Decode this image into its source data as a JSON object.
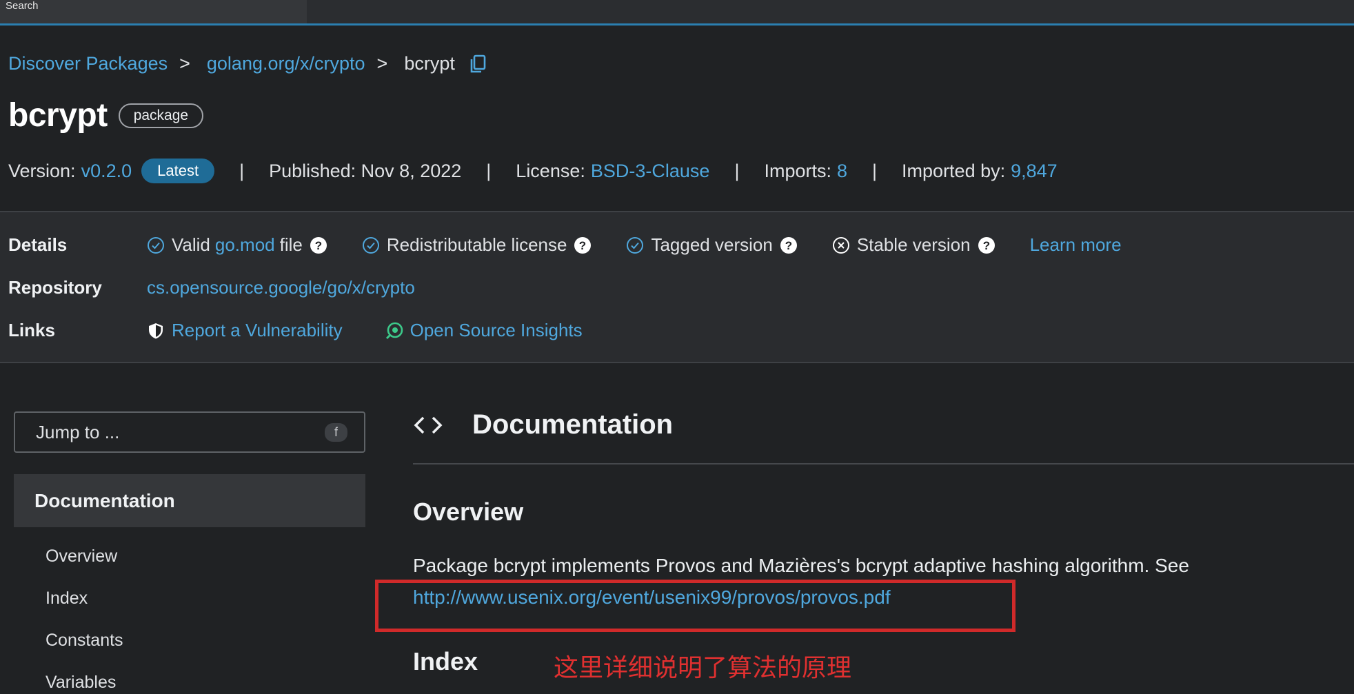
{
  "topbar": {
    "search_label": "Search"
  },
  "breadcrumb": {
    "root": "Discover Packages",
    "separator": ">",
    "module": "golang.org/x/crypto",
    "current": "bcrypt"
  },
  "package": {
    "name": "bcrypt",
    "kind_chip": "package"
  },
  "meta": {
    "version_label": "Version:",
    "version": "v0.2.0",
    "latest_badge": "Latest",
    "pipe": "|",
    "published": "Published: Nov 8, 2022",
    "license_label": "License:",
    "license": "BSD-3-Clause",
    "imports_label": "Imports:",
    "imports": "8",
    "imported_by_label": "Imported by:",
    "imported_by": "9,847"
  },
  "details": {
    "label": "Details",
    "valid_prefix": "Valid",
    "valid_link": "go.mod",
    "valid_suffix": "file",
    "redistributable": "Redistributable license",
    "tagged": "Tagged version",
    "stable": "Stable version",
    "learn_more": "Learn more"
  },
  "repository": {
    "label": "Repository",
    "url": "cs.opensource.google/go/x/crypto"
  },
  "links": {
    "label": "Links",
    "report": "Report a Vulnerability",
    "insights": "Open Source Insights"
  },
  "sidebar": {
    "jump_placeholder": "Jump to ...",
    "jump_key": "f",
    "section": "Documentation",
    "items": [
      "Overview",
      "Index",
      "Constants",
      "Variables"
    ]
  },
  "doc": {
    "title": "Documentation",
    "overview_heading": "Overview",
    "overview_text": "Package bcrypt implements Provos and Mazières's bcrypt adaptive hashing algorithm. See",
    "overview_link": "http://www.usenix.org/event/usenix99/provos/provos.pdf",
    "index_heading": "Index",
    "annotation": "这里详细说明了算法的原理"
  },
  "colors": {
    "background": "#202224",
    "link": "#4fa8de",
    "badge": "#1f6c97",
    "annotation_red": "#d02a2a"
  }
}
